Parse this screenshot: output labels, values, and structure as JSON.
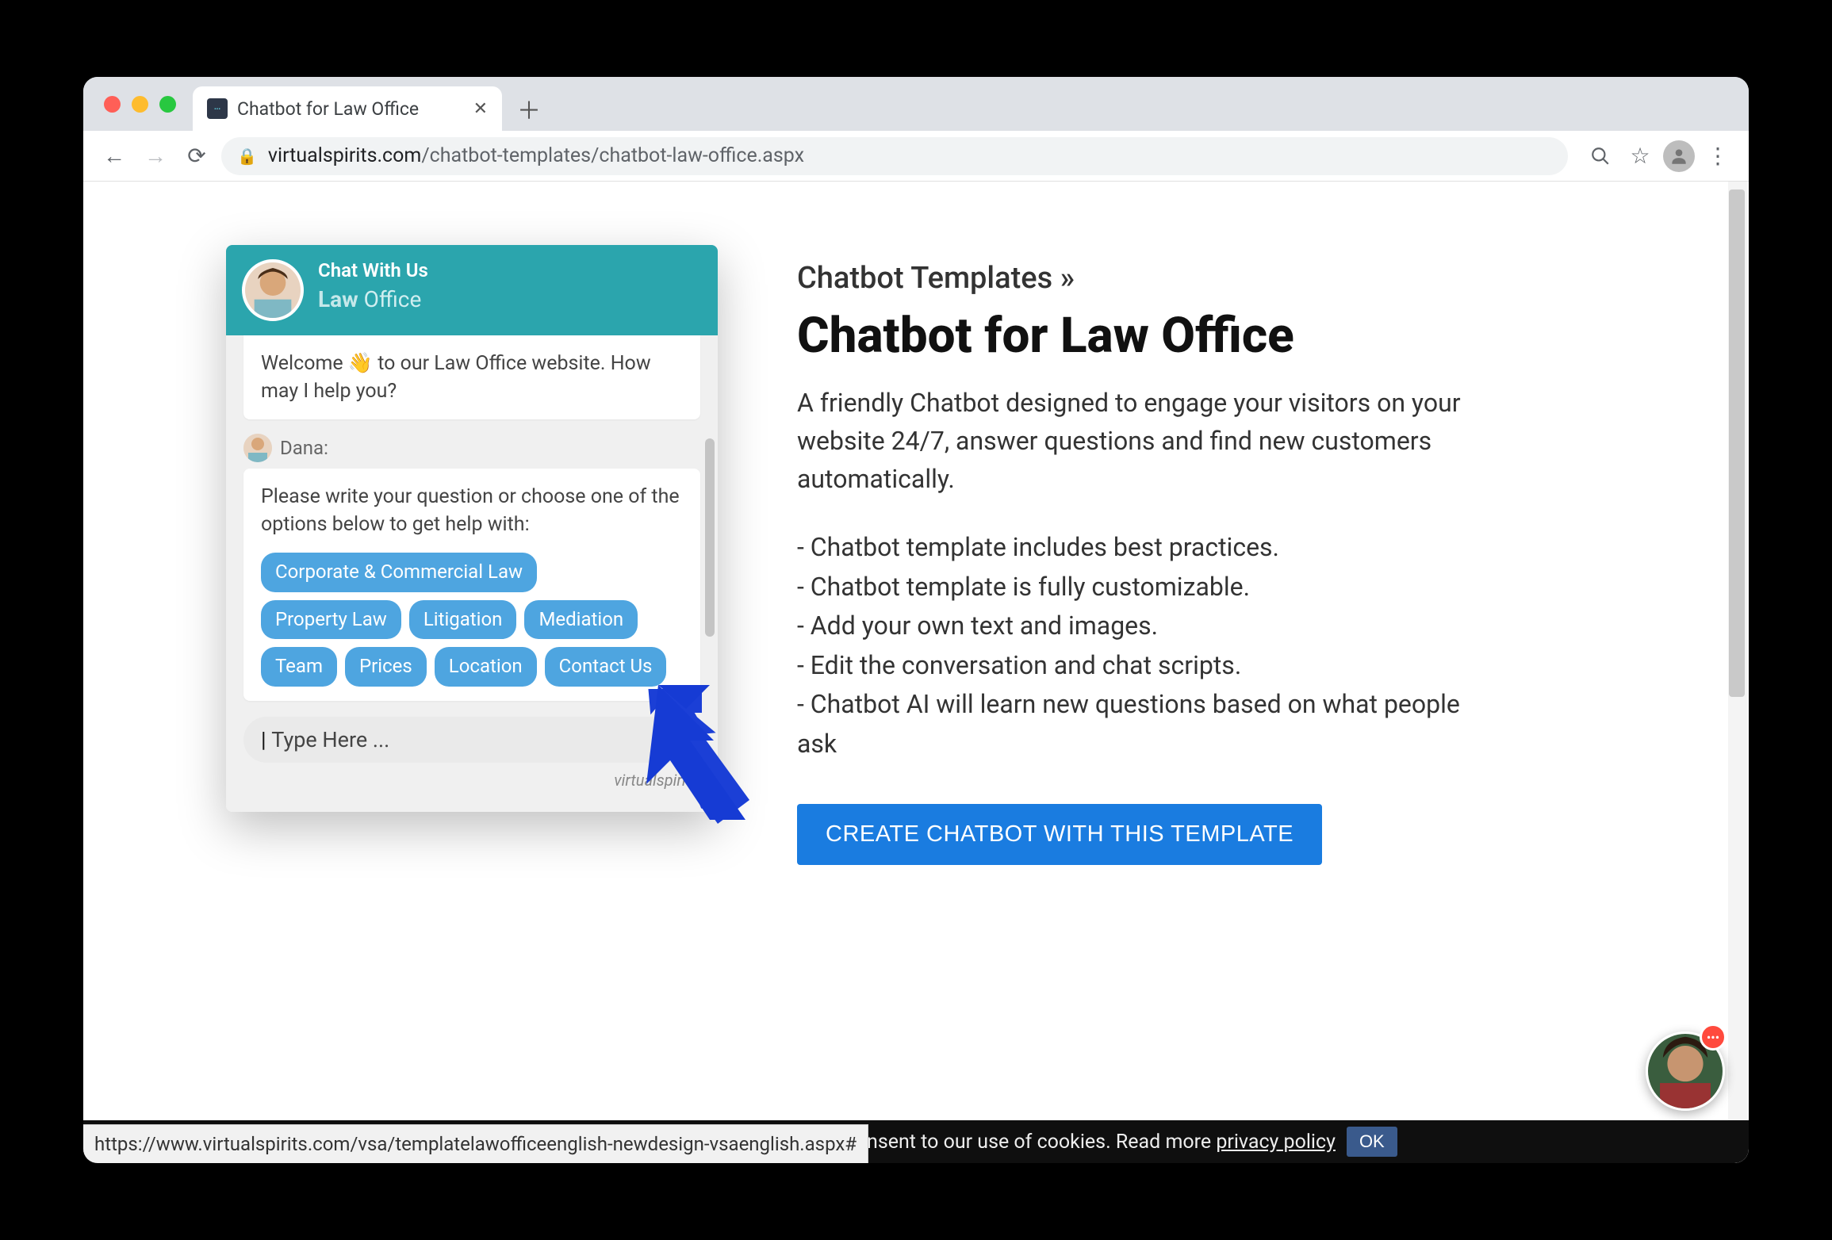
{
  "browser": {
    "tab_title": "Chatbot for Law Office",
    "url_host": "virtualspirits.com",
    "url_path": "/chatbot-templates/chatbot-law-office.aspx",
    "status_link": "https://www.virtualspirits.com/vsa/templatelawofficeenglish-newdesign-vsaenglish.aspx#"
  },
  "chat": {
    "header_line1": "Chat With Us",
    "header_brand_bold": "Law",
    "header_brand_rest": " Office",
    "welcome": "Welcome 👋 to our Law Office website. How may I help you?",
    "sender": "Dana:",
    "prompt": "Please write your question or choose one of the options below to get help with:",
    "chips": [
      "Corporate & Commercial Law",
      "Property Law",
      "Litigation",
      "Mediation",
      "Team",
      "Prices",
      "Location",
      "Contact Us"
    ],
    "input_placeholder": "Type Here ...",
    "footer": "virtualspirits"
  },
  "info": {
    "breadcrumb": "Chatbot Templates »",
    "title": "Chatbot for Law Office",
    "lead": "A friendly Chatbot designed to engage your visitors on your website 24/7, answer questions and find new customers automatically.",
    "bullets": [
      "- Chatbot template includes best practices.",
      "- Chatbot template is fully customizable.",
      "- Add your own text and images.",
      "- Edit the conversation and chat scripts.",
      "- Chatbot AI will learn new questions based on what people ask"
    ],
    "cta": "CREATE CHATBOT WITH THIS TEMPLATE"
  },
  "cookie": {
    "text_prefix": "This website uses cookies to offer you a better experience. By using our website you consent to our use of cookies. Read more ",
    "link": "privacy policy",
    "ok": "OK"
  }
}
